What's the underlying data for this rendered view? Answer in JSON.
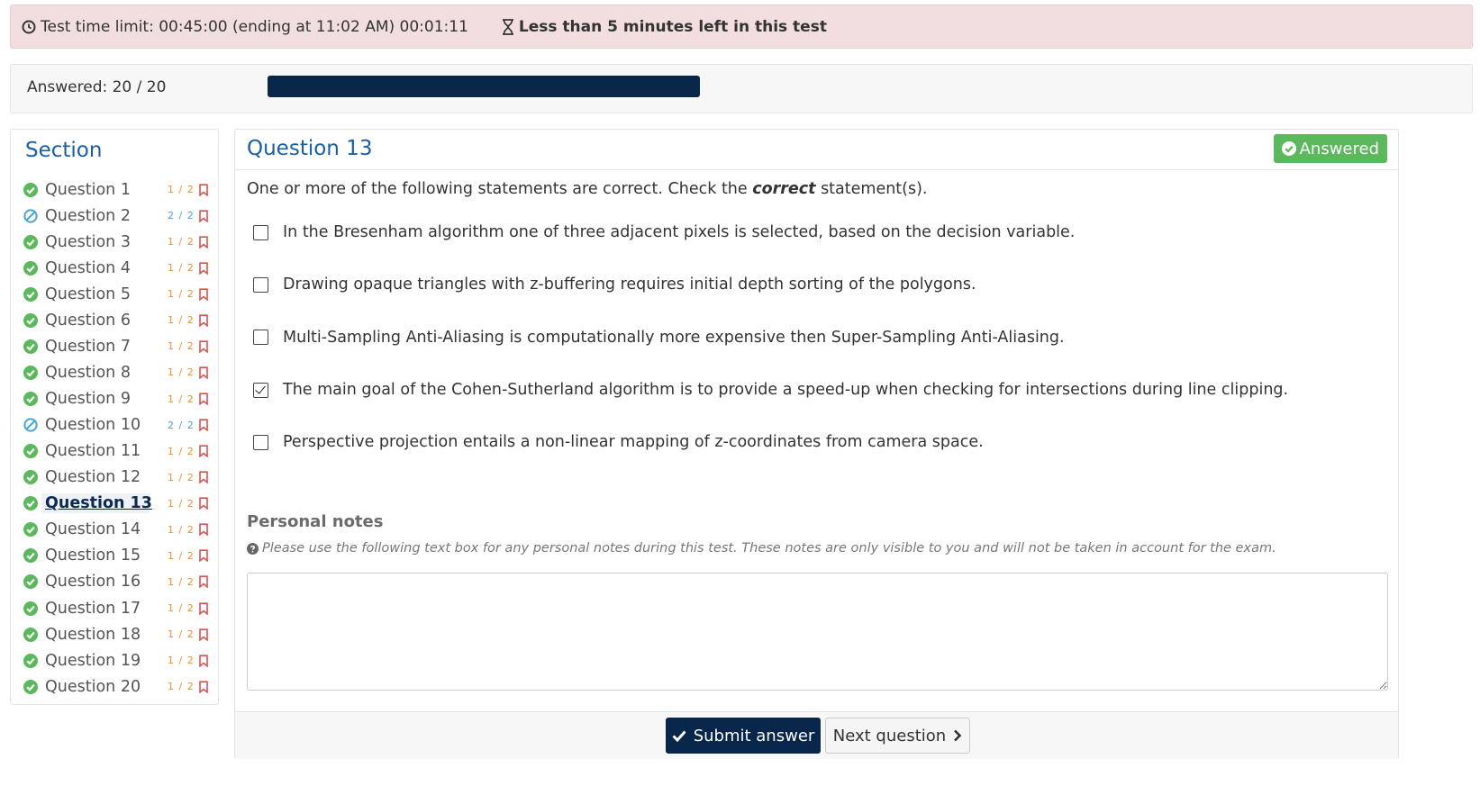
{
  "topbar": {
    "time_limit": "Test time limit: 00:45:00 (ending at 11:02 AM) 00:01:11",
    "warning": "Less than 5 minutes left in this test"
  },
  "progress": {
    "label": "Answered: 20 / 20",
    "answered": 20,
    "total": 20
  },
  "colors": {
    "accent": "#07264a",
    "title": "#1a5fa3",
    "answered_green": "#5cb85c",
    "score_orange": "#e8912d",
    "score_blue": "#4aa3d6",
    "bookmark_red": "#d9534f",
    "alert_bg": "#f2dede"
  },
  "section": {
    "title": "Section",
    "questions": [
      {
        "label": "Question 1",
        "status": "answered",
        "score": "1 / 2"
      },
      {
        "label": "Question 2",
        "status": "skipped",
        "score": "2 / 2"
      },
      {
        "label": "Question 3",
        "status": "answered",
        "score": "1 / 2"
      },
      {
        "label": "Question 4",
        "status": "answered",
        "score": "1 / 2"
      },
      {
        "label": "Question 5",
        "status": "answered",
        "score": "1 / 2"
      },
      {
        "label": "Question 6",
        "status": "answered",
        "score": "1 / 2"
      },
      {
        "label": "Question 7",
        "status": "answered",
        "score": "1 / 2"
      },
      {
        "label": "Question 8",
        "status": "answered",
        "score": "1 / 2"
      },
      {
        "label": "Question 9",
        "status": "answered",
        "score": "1 / 2"
      },
      {
        "label": "Question 10",
        "status": "skipped",
        "score": "2 / 2"
      },
      {
        "label": "Question 11",
        "status": "answered",
        "score": "1 / 2"
      },
      {
        "label": "Question 12",
        "status": "answered",
        "score": "1 / 2"
      },
      {
        "label": "Question 13",
        "status": "answered",
        "score": "1 / 2",
        "current": true
      },
      {
        "label": "Question 14",
        "status": "answered",
        "score": "1 / 2"
      },
      {
        "label": "Question 15",
        "status": "answered",
        "score": "1 / 2"
      },
      {
        "label": "Question 16",
        "status": "answered",
        "score": "1 / 2"
      },
      {
        "label": "Question 17",
        "status": "answered",
        "score": "1 / 2"
      },
      {
        "label": "Question 18",
        "status": "answered",
        "score": "1 / 2"
      },
      {
        "label": "Question 19",
        "status": "answered",
        "score": "1 / 2"
      },
      {
        "label": "Question 20",
        "status": "answered",
        "score": "1 / 2"
      }
    ]
  },
  "question": {
    "title": "Question 13",
    "badge": "Answered",
    "prompt_before": "One or more of the following statements are correct. Check the ",
    "prompt_emphasis": "correct",
    "prompt_after": " statement(s).",
    "options": [
      {
        "text": "In the Bresenham algorithm one of three adjacent pixels is selected, based on the decision variable.",
        "checked": false
      },
      {
        "text": "Drawing opaque triangles with z-buffering requires initial depth sorting of the polygons.",
        "checked": false
      },
      {
        "text": "Multi-Sampling Anti-Aliasing is computationally more expensive then Super-Sampling Anti-Aliasing.",
        "checked": false
      },
      {
        "text": "The main goal of the Cohen-Sutherland algorithm is to provide a speed-up when checking for intersections during line clipping.",
        "checked": true
      },
      {
        "text": "Perspective projection entails a non-linear mapping of z-coordinates from camera space.",
        "checked": false
      }
    ]
  },
  "notes": {
    "title": "Personal notes",
    "help": "Please use the following text box for any personal notes during this test. These notes are only visible to you and will not be taken in account for the exam.",
    "value": ""
  },
  "footer": {
    "submit_label": "Submit answer",
    "next_label": "Next question"
  }
}
